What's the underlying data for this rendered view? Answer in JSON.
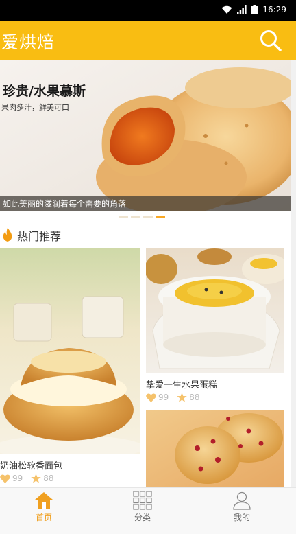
{
  "status_bar": {
    "time": "16:29"
  },
  "header": {
    "title": "爱烘焙"
  },
  "banner": {
    "title": "珍贵/水果慕斯",
    "subtitle": "果肉多汁，鲜美可口",
    "caption": "如此美丽的滋润着每个需要的角落",
    "active_dot": 4
  },
  "section": {
    "title": "热门推荐"
  },
  "cards": [
    {
      "name": "奶油松软香面包",
      "likes": "99",
      "stars": "88"
    },
    {
      "name": "挚爱一生水果蛋糕",
      "likes": "99",
      "stars": "88"
    }
  ],
  "nav": {
    "home": "首页",
    "category": "分类",
    "mine": "我的"
  },
  "colors": {
    "brand": "#f9bd12",
    "accent": "#f0a020"
  },
  "icons": [
    "search-icon",
    "fire-icon",
    "heart-icon",
    "star-icon",
    "home-icon",
    "grid-icon",
    "user-icon",
    "wifi-icon",
    "signal-icon",
    "battery-icon"
  ]
}
